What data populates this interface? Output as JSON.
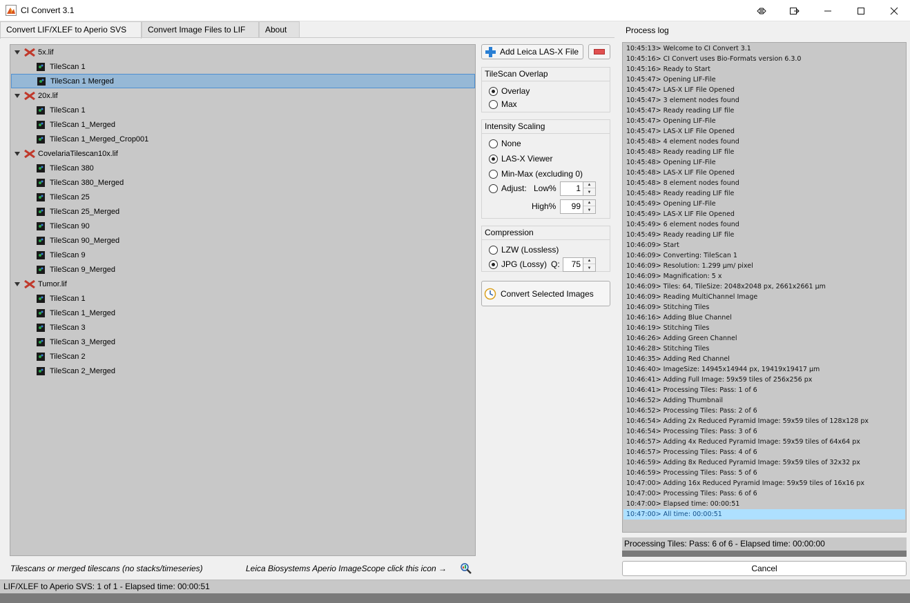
{
  "window": {
    "title": "CI Convert 3.1"
  },
  "tabs": [
    {
      "label": "Convert LIF/XLEF to Aperio SVS",
      "active": true
    },
    {
      "label": "Convert Image Files to LIF",
      "active": false
    },
    {
      "label": "About",
      "active": false
    }
  ],
  "tree": [
    {
      "label": "5x.lif",
      "type": "file"
    },
    {
      "label": "TileScan 1",
      "type": "scan"
    },
    {
      "label": "TileScan 1 Merged",
      "type": "scan",
      "selected": true
    },
    {
      "label": "20x.lif",
      "type": "file"
    },
    {
      "label": "TileScan 1",
      "type": "scan"
    },
    {
      "label": "TileScan 1_Merged",
      "type": "scan"
    },
    {
      "label": "TileScan 1_Merged_Crop001",
      "type": "scan"
    },
    {
      "label": "CovelariaTilescan10x.lif",
      "type": "file"
    },
    {
      "label": "TileScan 380",
      "type": "scan"
    },
    {
      "label": "TileScan 380_Merged",
      "type": "scan"
    },
    {
      "label": "TileScan 25",
      "type": "scan"
    },
    {
      "label": "TileScan 25_Merged",
      "type": "scan"
    },
    {
      "label": "TileScan 90",
      "type": "scan"
    },
    {
      "label": "TileScan 90_Merged",
      "type": "scan"
    },
    {
      "label": "TileScan 9",
      "type": "scan"
    },
    {
      "label": "TileScan 9_Merged",
      "type": "scan"
    },
    {
      "label": "Tumor.lif",
      "type": "file"
    },
    {
      "label": "TileScan 1",
      "type": "scan"
    },
    {
      "label": "TileScan 1_Merged",
      "type": "scan"
    },
    {
      "label": "TileScan 3",
      "type": "scan"
    },
    {
      "label": "TileScan 3_Merged",
      "type": "scan"
    },
    {
      "label": "TileScan 2",
      "type": "scan"
    },
    {
      "label": "TileScan 2_Merged",
      "type": "scan"
    }
  ],
  "footnotes": {
    "tree": "Tilescans or merged tilescans (no stacks/timeseries)",
    "imagescope": "Leica Biosystems Aperio ImageScope click this icon →"
  },
  "buttons": {
    "add_file": "Add Leica LAS-X File",
    "convert": "Convert Selected Images",
    "cancel": "Cancel"
  },
  "overlap": {
    "title": "TileScan Overlap",
    "options": [
      "Overlay",
      "Max"
    ],
    "selected": "Overlay"
  },
  "scaling": {
    "title": "Intensity Scaling",
    "options": [
      "None",
      "LAS-X Viewer",
      "Min-Max (excluding 0)",
      "Adjust:"
    ],
    "selected": "LAS-X Viewer",
    "low_label": "Low%",
    "low_value": "1",
    "high_label": "High%",
    "high_value": "99"
  },
  "compression": {
    "title": "Compression",
    "options": [
      "LZW (Lossless)",
      "JPG (Lossy)"
    ],
    "selected": "JPG (Lossy)",
    "q_label": "Q:",
    "q_value": "75"
  },
  "log": {
    "title": "Process log",
    "lines": [
      "10:45:13> Welcome to CI Convert 3.1",
      "10:45:16> CI Convert uses Bio-Formats version 6.3.0",
      "10:45:16> Ready to Start",
      "10:45:47> Opening LIF-File",
      "10:45:47> LAS-X LIF File Opened",
      "10:45:47> 3 element nodes found",
      "10:45:47> Ready reading LIF file",
      "10:45:47> Opening LIF-File",
      "10:45:47> LAS-X LIF File Opened",
      "10:45:48> 4 element nodes found",
      "10:45:48> Ready reading LIF file",
      "10:45:48> Opening LIF-File",
      "10:45:48> LAS-X LIF File Opened",
      "10:45:48> 8 element nodes found",
      "10:45:48> Ready reading LIF file",
      "10:45:49> Opening LIF-File",
      "10:45:49> LAS-X LIF File Opened",
      "10:45:49> 6 element nodes found",
      "10:45:49> Ready reading LIF file",
      "10:46:09> Start",
      "10:46:09> Converting: TileScan 1",
      "10:46:09> Resolution: 1.299 µm/ pixel",
      "10:46:09> Magnification: 5 x",
      "10:46:09> Tiles: 64, TileSize: 2048x2048 px, 2661x2661 µm",
      "10:46:09> Reading MultiChannel Image",
      "10:46:09> Stitching Tiles",
      "10:46:16> Adding Blue Channel",
      "10:46:19> Stitching Tiles",
      "10:46:26> Adding Green Channel",
      "10:46:28> Stitching Tiles",
      "10:46:35> Adding Red Channel",
      "10:46:40> ImageSize: 14945x14944 px, 19419x19417 µm",
      "10:46:41> Adding Full Image: 59x59 tiles of 256x256 px",
      "10:46:41> Processing Tiles: Pass: 1 of 6",
      "10:46:52> Adding Thumbnail",
      "10:46:52> Processing Tiles: Pass: 2 of 6",
      "10:46:54> Adding 2x Reduced Pyramid Image: 59x59 tiles of 128x128 px",
      "10:46:54> Processing Tiles: Pass: 3 of 6",
      "10:46:57> Adding 4x Reduced Pyramid Image: 59x59 tiles of 64x64 px",
      "10:46:57> Processing Tiles: Pass: 4 of 6",
      "10:46:59> Adding 8x Reduced Pyramid Image: 59x59 tiles of 32x32 px",
      "10:46:59> Processing Tiles: Pass: 5 of 6",
      "10:47:00> Adding 16x Reduced Pyramid Image: 59x59 tiles of 16x16 px",
      "10:47:00> Processing Tiles: Pass: 6 of 6",
      "10:47:00> Elapsed time: 00:00:51",
      "10:47:00> All time: 00:00:51"
    ],
    "highlighted_index": 45
  },
  "progress": {
    "text": "Processing Tiles: Pass: 6 of 6 - Elapsed time: 00:00:00"
  },
  "status": {
    "text": "LIF/XLEF to Aperio SVS: 1 of 1 - Elapsed time: 00:00:51"
  },
  "colors": {
    "panel_bg": "#c8c8c8",
    "selection": "#96b8d6",
    "log_highlight": "#aee0ff",
    "lif_icon": "#c0392b",
    "add_icon": "#2a7fd4",
    "remove_icon": "#e05050"
  }
}
